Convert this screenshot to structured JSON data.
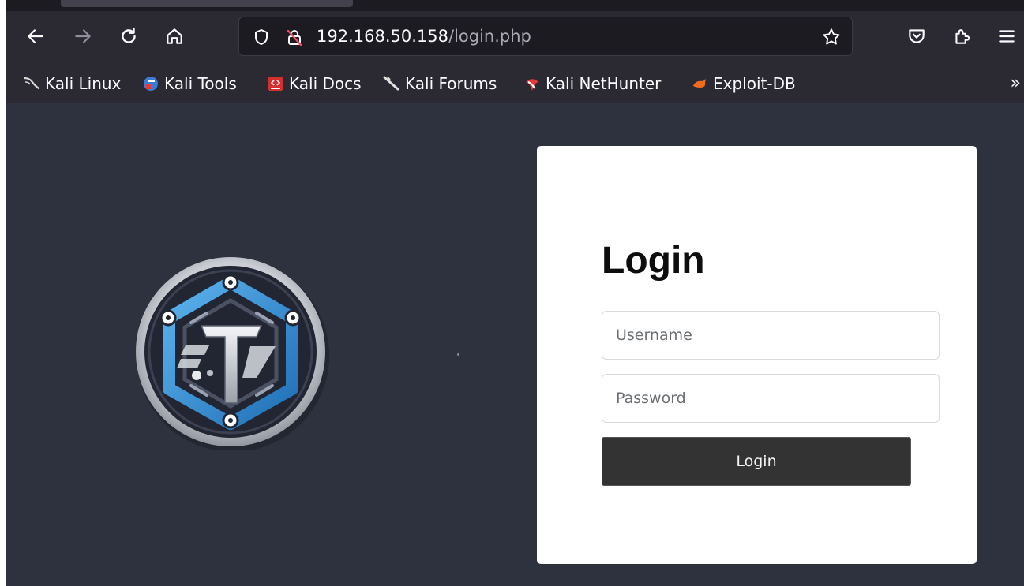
{
  "browser": {
    "nav": {
      "back_icon": "arrow-left-icon",
      "forward_icon": "arrow-right-icon",
      "reload_icon": "reload-icon",
      "home_icon": "home-icon"
    },
    "url": {
      "host": "192.168.50.158",
      "path": "/login.php"
    },
    "bookmarks": [
      {
        "label": "Kali Linux",
        "icon": "kali-dragon-icon"
      },
      {
        "label": "Kali Tools",
        "icon": "kali-tools-icon"
      },
      {
        "label": "Kali Docs",
        "icon": "kali-docs-icon"
      },
      {
        "label": "Kali Forums",
        "icon": "kali-forums-icon"
      },
      {
        "label": "Kali NetHunter",
        "icon": "nethunter-icon"
      },
      {
        "label": "Exploit-DB",
        "icon": "exploit-db-icon"
      }
    ],
    "overflow_label": "»"
  },
  "login": {
    "title": "Login",
    "username_placeholder": "Username",
    "password_placeholder": "Password",
    "submit_label": "Login"
  },
  "colors": {
    "page_background": "#2e323f",
    "card_background": "#ffffff",
    "button_background": "#333333",
    "logo_accent": "#3a93d6"
  }
}
